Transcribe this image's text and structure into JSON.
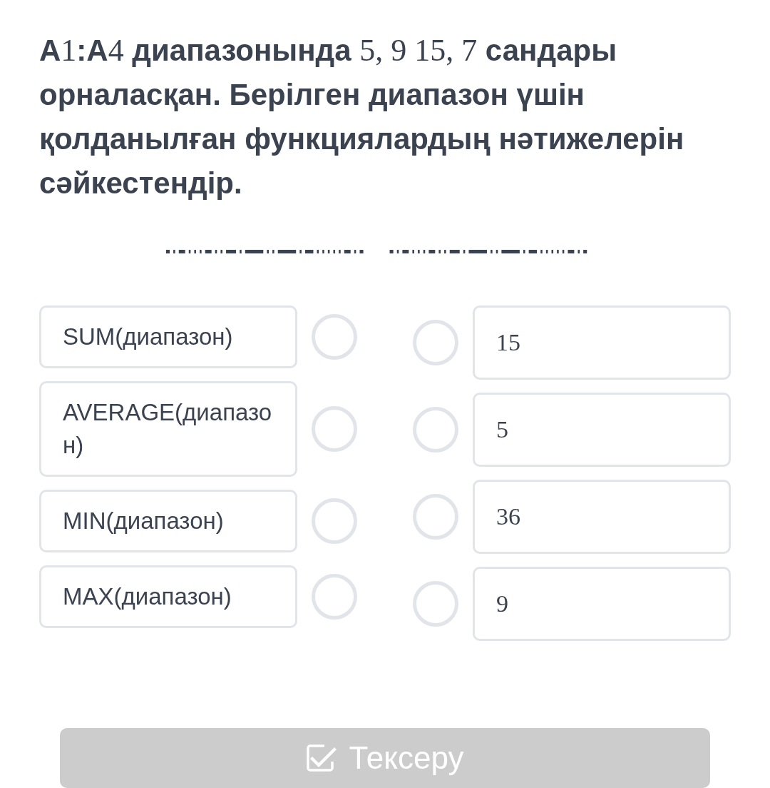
{
  "question": [
    {
      "kind": "text",
      "text": "A"
    },
    {
      "kind": "math",
      "text": "1"
    },
    {
      "kind": "text",
      "text": ":A"
    },
    {
      "kind": "math",
      "text": "4"
    },
    {
      "kind": "text",
      "text": " диапазонында "
    },
    {
      "kind": "math",
      "text": "5, 9 15, 7"
    },
    {
      "kind": "text",
      "text": " сандары орналасқан. Берілген диапазон үшін қолданылған функциялардың нәтижелерін сәйкестендір."
    }
  ],
  "left_items": [
    {
      "text": "SUM(диапазон)"
    },
    {
      "text": "AVERAGE(диапазон)"
    },
    {
      "text": "MIN(диапазон)"
    },
    {
      "text": "MAX(диапазон)"
    }
  ],
  "right_items": [
    {
      "text": "15"
    },
    {
      "text": "5"
    },
    {
      "text": "36"
    },
    {
      "text": "9"
    }
  ],
  "check_button": {
    "label": "Тексеру",
    "disabled": true
  }
}
